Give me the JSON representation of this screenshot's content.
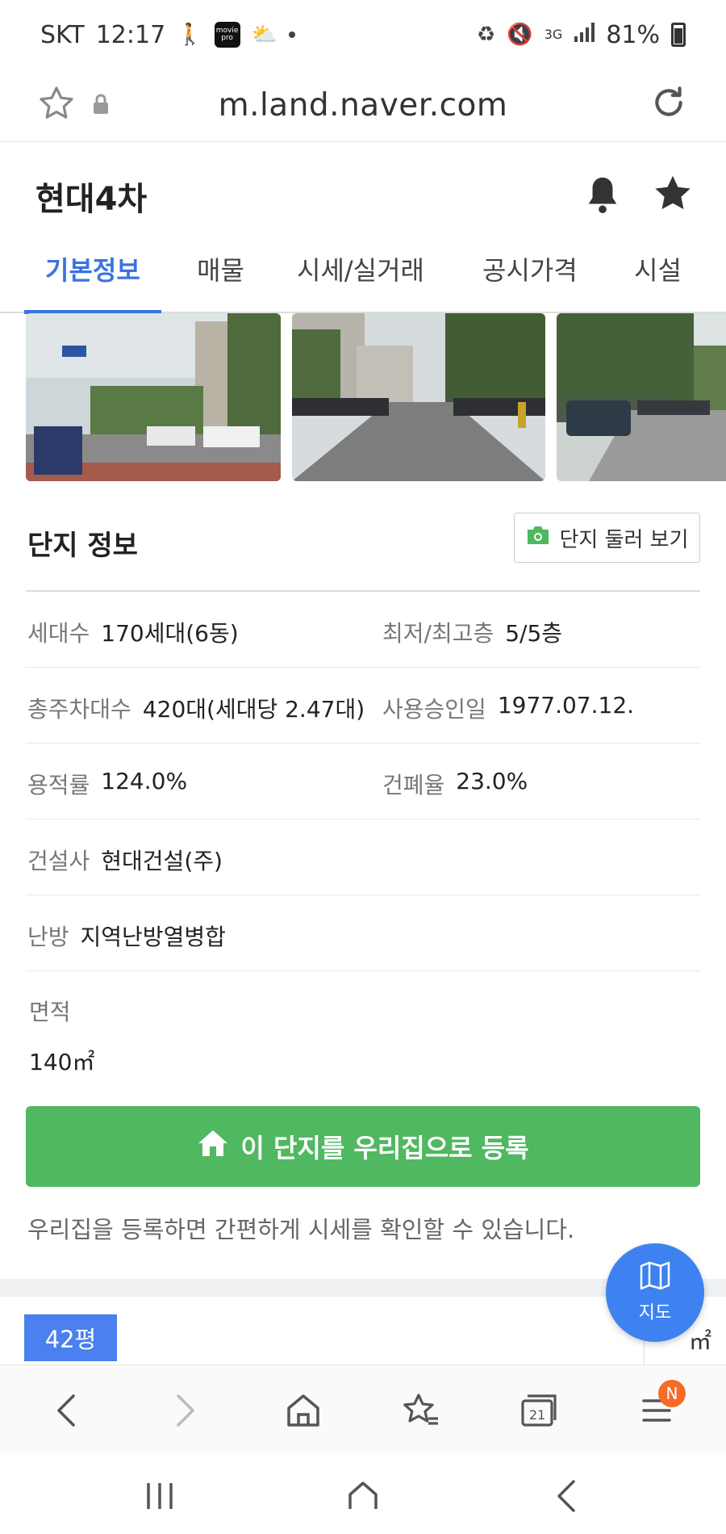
{
  "status_bar": {
    "carrier": "SKT",
    "time": "12:17",
    "app_badge": "movie pro",
    "network": "3G",
    "battery": "81%"
  },
  "browser": {
    "url": "m.land.naver.com",
    "tab_count": "21",
    "menu_badge": "N"
  },
  "header": {
    "title": "현대4차"
  },
  "tabs": [
    {
      "label": "기본정보",
      "active": true
    },
    {
      "label": "매물"
    },
    {
      "label": "시세/실거래"
    },
    {
      "label": "공시가격"
    },
    {
      "label": "시설"
    }
  ],
  "complex": {
    "section_title": "단지 정보",
    "tour_button": "단지 둘러 보기",
    "rows": [
      {
        "l_label": "세대수",
        "l_value": "170세대(6동)",
        "r_label": "최저/최고층",
        "r_value": "5/5층"
      },
      {
        "l_label": "총주차대수",
        "l_value": "420대(세대당 2.47대)",
        "r_label": "사용승인일",
        "r_value": "1977.07.12."
      },
      {
        "l_label": "용적률",
        "l_value": "124.0%",
        "r_label": "건폐율",
        "r_value": "23.0%"
      },
      {
        "l_label": "건설사",
        "l_value": "현대건설(주)"
      },
      {
        "l_label": "난방",
        "l_value": "지역난방열병합"
      }
    ],
    "area_label": "면적",
    "area_value": "140㎡",
    "register_button": "이 단지를 우리집으로 등록",
    "register_note": "우리집을 등록하면 간편하게 시세를 확인할 수 있습니다."
  },
  "bottom_section": {
    "pyeong_tag": "42평",
    "sqm_text": "㎡"
  },
  "map_button": {
    "label": "지도"
  },
  "colors": {
    "accent_blue": "#3a73e2",
    "register_green": "#4fb860",
    "fab_blue": "#3d82f0",
    "badge_orange": "#f46b2a"
  }
}
